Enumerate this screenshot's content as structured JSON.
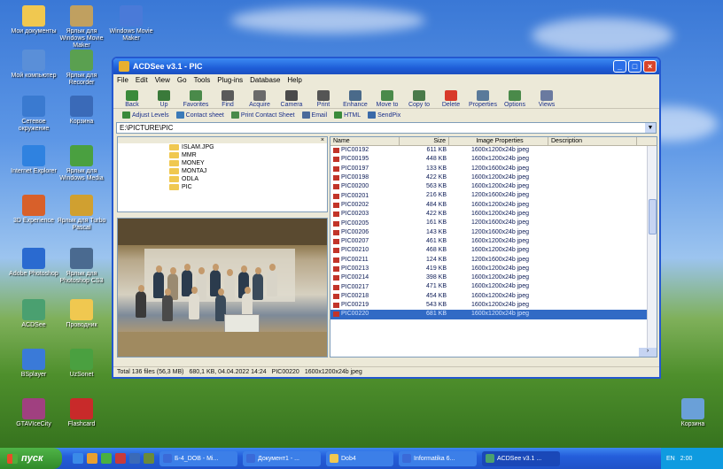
{
  "desktop": {
    "icons": [
      {
        "label": "Мои документы",
        "color": "#f0c850"
      },
      {
        "label": "Ярлык для Windows Movie Maker",
        "color": "#c0a060"
      },
      {
        "label": "Windows Movie Maker",
        "color": "#4a7ad8"
      },
      {
        "label": "Мой компьютер",
        "color": "#5a8fd8"
      },
      {
        "label": "Ярлык для Recorder",
        "color": "#5aa050"
      },
      {
        "label": "Сетевое окружение",
        "color": "#3a7ad0"
      },
      {
        "label": "Корзина",
        "color": "#3a6ab8"
      },
      {
        "label": "Internet Explorer",
        "color": "#2f82e0"
      },
      {
        "label": "Ярлык для Windows Media",
        "color": "#4aa040"
      },
      {
        "label": "3D Experience",
        "color": "#d8602a"
      },
      {
        "label": "Ярлык для Turbo Pascal",
        "color": "#d0a030"
      },
      {
        "label": "Adobe Photoshop",
        "color": "#2a6ad0"
      },
      {
        "label": "Ярлык для Photoshop CS3",
        "color": "#4a6a90"
      },
      {
        "label": "ACDSee",
        "color": "#4aa070"
      },
      {
        "label": "Проводник",
        "color": "#f0c850"
      },
      {
        "label": "BSplayer",
        "color": "#3a7ad8"
      },
      {
        "label": "UzSonet",
        "color": "#4aa040"
      },
      {
        "label": "GTAVIceCity",
        "color": "#a04080"
      },
      {
        "label": "Flashcard",
        "color": "#c82a2a"
      },
      {
        "label": "Корзина",
        "color": "#6aa0d8"
      }
    ]
  },
  "window": {
    "title": "ACDSee v3.1 - PIC",
    "menu": [
      "File",
      "Edit",
      "View",
      "Go",
      "Tools",
      "Plug-ins",
      "Database",
      "Help"
    ],
    "toolbar": [
      {
        "label": "Back",
        "color": "#3a8a3a"
      },
      {
        "label": "Up",
        "color": "#3a7a3a"
      },
      {
        "label": "Favorites",
        "color": "#4a8a4a"
      },
      {
        "label": "Find",
        "color": "#5a5a5a"
      },
      {
        "label": "Acquire",
        "color": "#6a6a6a"
      },
      {
        "label": "Camera",
        "color": "#4a4a4a"
      },
      {
        "label": "Print",
        "color": "#555555"
      },
      {
        "label": "Enhance",
        "color": "#4a6a8a"
      },
      {
        "label": "Move to",
        "color": "#4a8a4a"
      },
      {
        "label": "Copy to",
        "color": "#4a7a4a"
      },
      {
        "label": "Delete",
        "color": "#d83a2a"
      },
      {
        "label": "Properties",
        "color": "#5a7a9a"
      },
      {
        "label": "Options",
        "color": "#4a8a4a"
      },
      {
        "label": "Views",
        "color": "#6a7aa0"
      }
    ],
    "toolbar2": [
      {
        "label": "Adjust Levels",
        "color": "#3a8a3a"
      },
      {
        "label": "Contact sheet",
        "color": "#3a7ab8"
      },
      {
        "label": "Print Contact Sheet",
        "color": "#4a8a4a"
      },
      {
        "label": "Email",
        "color": "#4a6a9a"
      },
      {
        "label": "HTML",
        "color": "#3a8a3a"
      },
      {
        "label": "SendPix",
        "color": "#3a6aa8"
      }
    ],
    "address": "E:\\PICTURE\\PIC",
    "tree": [
      "ISLAM.JPG",
      "MMR",
      "MONEY",
      "MONTAJ",
      "ODLA",
      "PIC"
    ],
    "columns": {
      "name": "Name",
      "size": "Size",
      "props": "Image Properties",
      "desc": "Description"
    },
    "files": [
      {
        "name": "PIC00192",
        "size": "611 KB",
        "props": "1600x1200x24b jpeg"
      },
      {
        "name": "PIC00195",
        "size": "448 KB",
        "props": "1600x1200x24b jpeg"
      },
      {
        "name": "PIC00197",
        "size": "133 KB",
        "props": "1200x1600x24b jpeg"
      },
      {
        "name": "PIC00198",
        "size": "422 KB",
        "props": "1600x1200x24b jpeg"
      },
      {
        "name": "PIC00200",
        "size": "563 KB",
        "props": "1600x1200x24b jpeg"
      },
      {
        "name": "PIC00201",
        "size": "216 KB",
        "props": "1200x1600x24b jpeg"
      },
      {
        "name": "PIC00202",
        "size": "484 KB",
        "props": "1600x1200x24b jpeg"
      },
      {
        "name": "PIC00203",
        "size": "422 KB",
        "props": "1600x1200x24b jpeg"
      },
      {
        "name": "PIC00205",
        "size": "161 KB",
        "props": "1200x1600x24b jpeg"
      },
      {
        "name": "PIC00206",
        "size": "143 KB",
        "props": "1200x1600x24b jpeg"
      },
      {
        "name": "PIC00207",
        "size": "461 KB",
        "props": "1600x1200x24b jpeg"
      },
      {
        "name": "PIC00210",
        "size": "468 KB",
        "props": "1600x1200x24b jpeg"
      },
      {
        "name": "PIC00211",
        "size": "124 KB",
        "props": "1200x1600x24b jpeg"
      },
      {
        "name": "PIC00213",
        "size": "419 KB",
        "props": "1600x1200x24b jpeg"
      },
      {
        "name": "PIC00214",
        "size": "398 KB",
        "props": "1600x1200x24b jpeg"
      },
      {
        "name": "PIC00217",
        "size": "471 KB",
        "props": "1600x1200x24b jpeg"
      },
      {
        "name": "PIC00218",
        "size": "454 KB",
        "props": "1600x1200x24b jpeg"
      },
      {
        "name": "PIC00219",
        "size": "543 KB",
        "props": "1600x1200x24b jpeg"
      },
      {
        "name": "PIC00220",
        "size": "681 KB",
        "props": "1600x1200x24b jpeg",
        "selected": true
      }
    ],
    "status": {
      "total": "Total 136 files (56,3 MB)",
      "detail": "680,1 KB, 04.04.2022 14:24",
      "file": "PIC00220",
      "props": "1600x1200x24b jpeg"
    }
  },
  "taskbar": {
    "start": "пуск",
    "quicklaunch": [
      "#3a8ae8",
      "#e8a030",
      "#4ab040",
      "#c83a3a",
      "#3a6ab8",
      "#6a8a3a"
    ],
    "tasks": [
      {
        "label": "Б-4_DOB - Mi...",
        "color": "#3a6ad8"
      },
      {
        "label": "Документ1 - ...",
        "color": "#3a6ad8"
      },
      {
        "label": "Dob4",
        "color": "#f0c850"
      },
      {
        "label": "Informatika 6...",
        "color": "#3a6ad8"
      },
      {
        "label": "ACDSee v3.1 ...",
        "color": "#4aa070",
        "active": true
      }
    ],
    "lang": "EN",
    "clock": "2:00"
  }
}
